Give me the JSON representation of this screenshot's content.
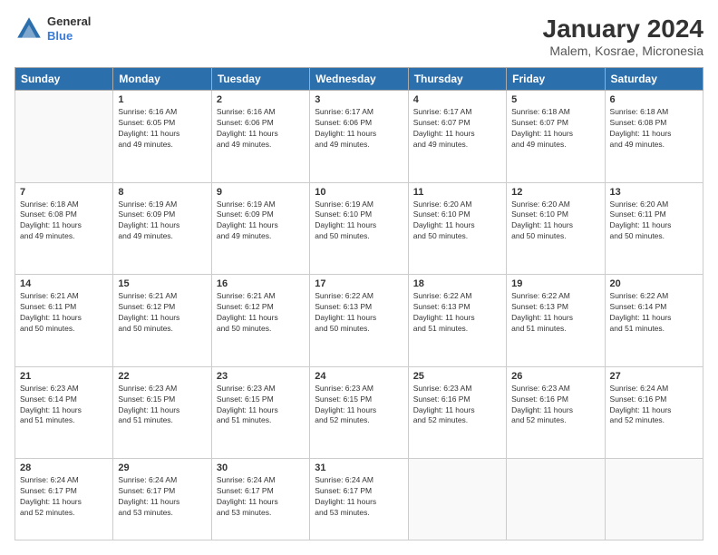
{
  "header": {
    "logo_line1": "General",
    "logo_line2": "Blue",
    "title": "January 2024",
    "subtitle": "Malem, Kosrae, Micronesia"
  },
  "days": [
    "Sunday",
    "Monday",
    "Tuesday",
    "Wednesday",
    "Thursday",
    "Friday",
    "Saturday"
  ],
  "weeks": [
    [
      {
        "num": "",
        "text": ""
      },
      {
        "num": "1",
        "text": "Sunrise: 6:16 AM\nSunset: 6:05 PM\nDaylight: 11 hours\nand 49 minutes."
      },
      {
        "num": "2",
        "text": "Sunrise: 6:16 AM\nSunset: 6:06 PM\nDaylight: 11 hours\nand 49 minutes."
      },
      {
        "num": "3",
        "text": "Sunrise: 6:17 AM\nSunset: 6:06 PM\nDaylight: 11 hours\nand 49 minutes."
      },
      {
        "num": "4",
        "text": "Sunrise: 6:17 AM\nSunset: 6:07 PM\nDaylight: 11 hours\nand 49 minutes."
      },
      {
        "num": "5",
        "text": "Sunrise: 6:18 AM\nSunset: 6:07 PM\nDaylight: 11 hours\nand 49 minutes."
      },
      {
        "num": "6",
        "text": "Sunrise: 6:18 AM\nSunset: 6:08 PM\nDaylight: 11 hours\nand 49 minutes."
      }
    ],
    [
      {
        "num": "7",
        "text": "Sunrise: 6:18 AM\nSunset: 6:08 PM\nDaylight: 11 hours\nand 49 minutes."
      },
      {
        "num": "8",
        "text": "Sunrise: 6:19 AM\nSunset: 6:09 PM\nDaylight: 11 hours\nand 49 minutes."
      },
      {
        "num": "9",
        "text": "Sunrise: 6:19 AM\nSunset: 6:09 PM\nDaylight: 11 hours\nand 49 minutes."
      },
      {
        "num": "10",
        "text": "Sunrise: 6:19 AM\nSunset: 6:10 PM\nDaylight: 11 hours\nand 50 minutes."
      },
      {
        "num": "11",
        "text": "Sunrise: 6:20 AM\nSunset: 6:10 PM\nDaylight: 11 hours\nand 50 minutes."
      },
      {
        "num": "12",
        "text": "Sunrise: 6:20 AM\nSunset: 6:10 PM\nDaylight: 11 hours\nand 50 minutes."
      },
      {
        "num": "13",
        "text": "Sunrise: 6:20 AM\nSunset: 6:11 PM\nDaylight: 11 hours\nand 50 minutes."
      }
    ],
    [
      {
        "num": "14",
        "text": "Sunrise: 6:21 AM\nSunset: 6:11 PM\nDaylight: 11 hours\nand 50 minutes."
      },
      {
        "num": "15",
        "text": "Sunrise: 6:21 AM\nSunset: 6:12 PM\nDaylight: 11 hours\nand 50 minutes."
      },
      {
        "num": "16",
        "text": "Sunrise: 6:21 AM\nSunset: 6:12 PM\nDaylight: 11 hours\nand 50 minutes."
      },
      {
        "num": "17",
        "text": "Sunrise: 6:22 AM\nSunset: 6:13 PM\nDaylight: 11 hours\nand 50 minutes."
      },
      {
        "num": "18",
        "text": "Sunrise: 6:22 AM\nSunset: 6:13 PM\nDaylight: 11 hours\nand 51 minutes."
      },
      {
        "num": "19",
        "text": "Sunrise: 6:22 AM\nSunset: 6:13 PM\nDaylight: 11 hours\nand 51 minutes."
      },
      {
        "num": "20",
        "text": "Sunrise: 6:22 AM\nSunset: 6:14 PM\nDaylight: 11 hours\nand 51 minutes."
      }
    ],
    [
      {
        "num": "21",
        "text": "Sunrise: 6:23 AM\nSunset: 6:14 PM\nDaylight: 11 hours\nand 51 minutes."
      },
      {
        "num": "22",
        "text": "Sunrise: 6:23 AM\nSunset: 6:15 PM\nDaylight: 11 hours\nand 51 minutes."
      },
      {
        "num": "23",
        "text": "Sunrise: 6:23 AM\nSunset: 6:15 PM\nDaylight: 11 hours\nand 51 minutes."
      },
      {
        "num": "24",
        "text": "Sunrise: 6:23 AM\nSunset: 6:15 PM\nDaylight: 11 hours\nand 52 minutes."
      },
      {
        "num": "25",
        "text": "Sunrise: 6:23 AM\nSunset: 6:16 PM\nDaylight: 11 hours\nand 52 minutes."
      },
      {
        "num": "26",
        "text": "Sunrise: 6:23 AM\nSunset: 6:16 PM\nDaylight: 11 hours\nand 52 minutes."
      },
      {
        "num": "27",
        "text": "Sunrise: 6:24 AM\nSunset: 6:16 PM\nDaylight: 11 hours\nand 52 minutes."
      }
    ],
    [
      {
        "num": "28",
        "text": "Sunrise: 6:24 AM\nSunset: 6:17 PM\nDaylight: 11 hours\nand 52 minutes."
      },
      {
        "num": "29",
        "text": "Sunrise: 6:24 AM\nSunset: 6:17 PM\nDaylight: 11 hours\nand 53 minutes."
      },
      {
        "num": "30",
        "text": "Sunrise: 6:24 AM\nSunset: 6:17 PM\nDaylight: 11 hours\nand 53 minutes."
      },
      {
        "num": "31",
        "text": "Sunrise: 6:24 AM\nSunset: 6:17 PM\nDaylight: 11 hours\nand 53 minutes."
      },
      {
        "num": "",
        "text": ""
      },
      {
        "num": "",
        "text": ""
      },
      {
        "num": "",
        "text": ""
      }
    ]
  ]
}
